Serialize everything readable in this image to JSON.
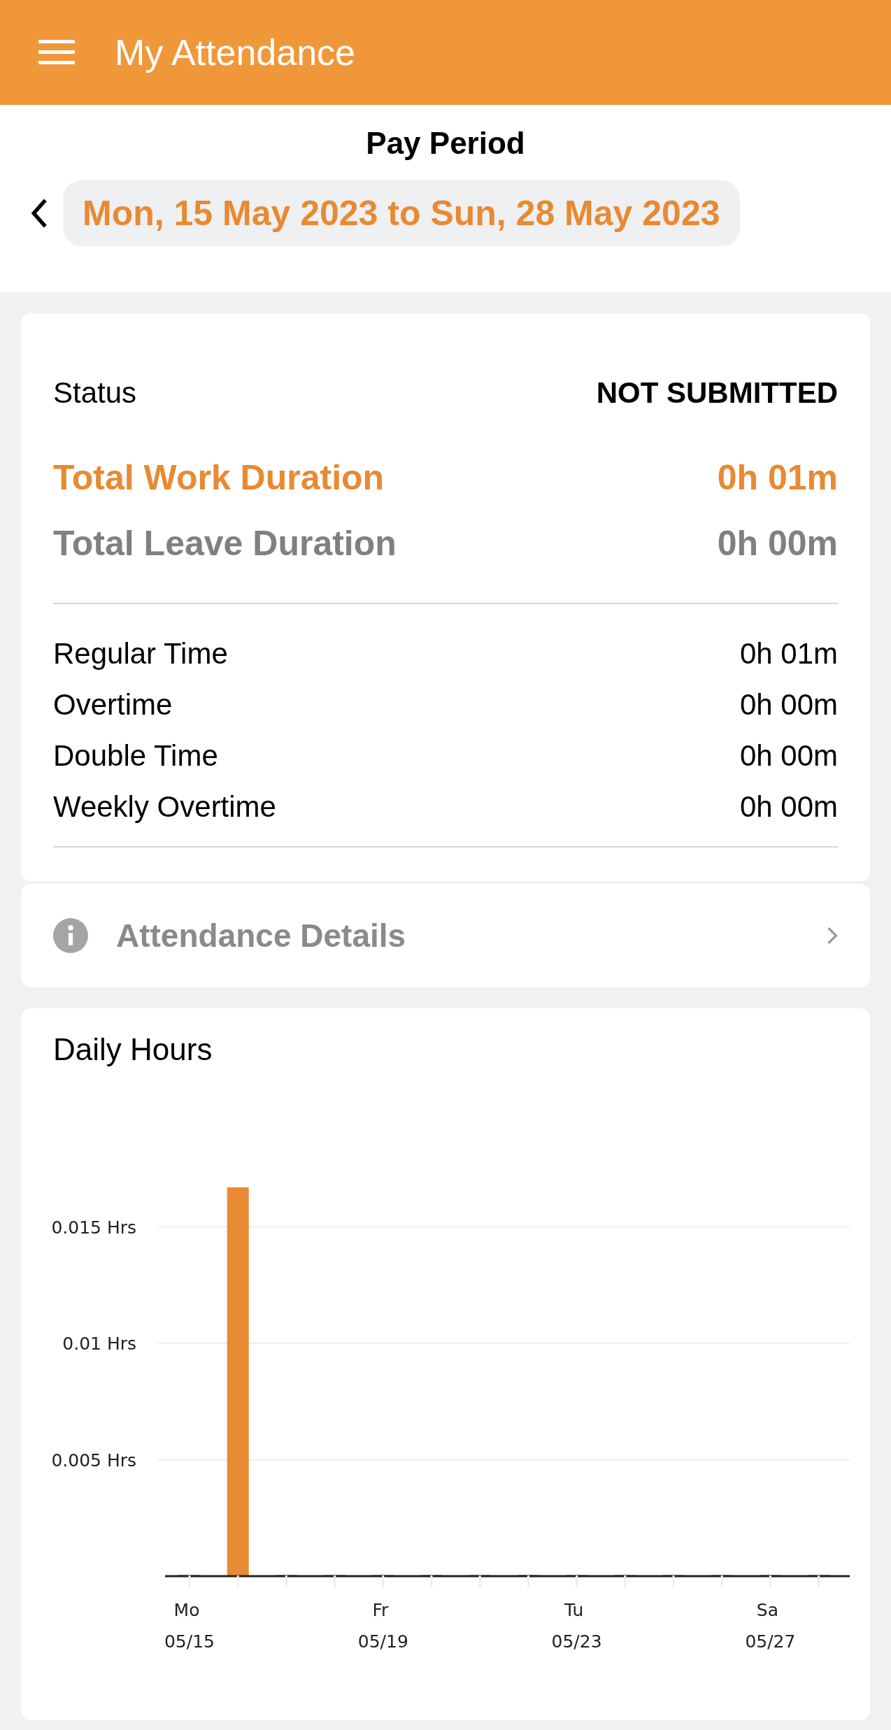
{
  "header": {
    "title": "My Attendance"
  },
  "pay_period": {
    "label": "Pay Period",
    "range": "Mon, 15 May 2023 to Sun, 28 May 2023"
  },
  "summary": {
    "status_label": "Status",
    "status_value": "NOT SUBMITTED",
    "totals": [
      {
        "kind": "work",
        "label": "Total Work Duration",
        "value": "0h 01m"
      },
      {
        "kind": "leave",
        "label": "Total Leave Duration",
        "value": "0h 00m"
      }
    ],
    "breakdown": [
      {
        "label": "Regular Time",
        "value": "0h 01m"
      },
      {
        "label": "Overtime",
        "value": "0h 00m"
      },
      {
        "label": "Double Time",
        "value": "0h 00m"
      },
      {
        "label": "Weekly Overtime",
        "value": "0h 00m"
      }
    ]
  },
  "details_link": {
    "label": "Attendance Details"
  },
  "daily_hours": {
    "title": "Daily Hours",
    "chart_data": {
      "type": "bar",
      "categories": [
        "Mo 05/15",
        null,
        null,
        null,
        "Fr 05/19",
        null,
        null,
        null,
        "Tu 05/23",
        null,
        null,
        null,
        "Sa 05/27",
        null
      ],
      "series": [
        {
          "color": "#e88a33",
          "values": [
            0,
            0.0167,
            0,
            0,
            0,
            0,
            0,
            0,
            0,
            0,
            0,
            0,
            0,
            0
          ]
        }
      ],
      "grid": true,
      "ylim": [
        0,
        0.0167
      ],
      "yticks": [
        {
          "value": 0.005,
          "label": "0.005 Hrs"
        },
        {
          "value": 0.01,
          "label": "0.01 Hrs"
        },
        {
          "value": 0.015,
          "label": "0.015 Hrs"
        }
      ]
    }
  }
}
